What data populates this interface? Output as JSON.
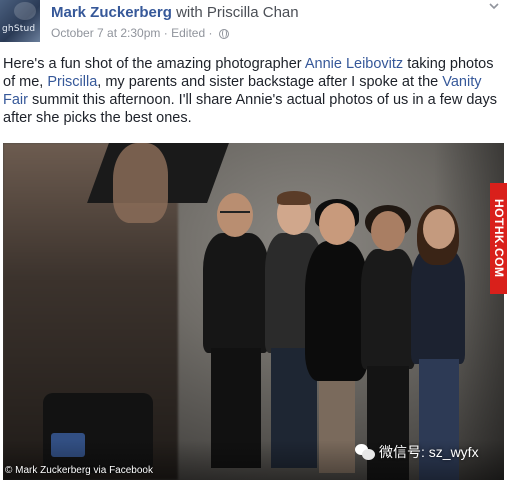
{
  "post": {
    "author": "Mark Zuckerberg",
    "with_text": "with",
    "tagged": "Priscilla Chan",
    "date": "October 7 at 2:30pm",
    "separator": "·",
    "edited": "Edited",
    "separator2": "·",
    "avatar_text": "ghStud",
    "text_parts": {
      "p1": "Here's a fun shot of the amazing photographer ",
      "tag1": "Annie Leibovitz",
      "p2": " taking photos of me, ",
      "tag2": "Priscilla",
      "p3": ", my parents and sister backstage after I spoke at the ",
      "tag3": "Vanity Fair",
      "p4": " summit this afternoon. I'll share Annie's actual photos of us in a few days after she picks the best ones."
    }
  },
  "photo": {
    "side_watermark": "HOTHK.COM",
    "credit": "© Mark Zuckerberg via Facebook",
    "wechat_label": "微信号: sz_wyfx"
  },
  "icons": [
    "avatar",
    "globe-icon",
    "chevron-down-icon",
    "wechat-icon"
  ],
  "colors": {
    "link": "#365899",
    "meta": "#90949c",
    "watermark_bg": "#d9201b"
  }
}
